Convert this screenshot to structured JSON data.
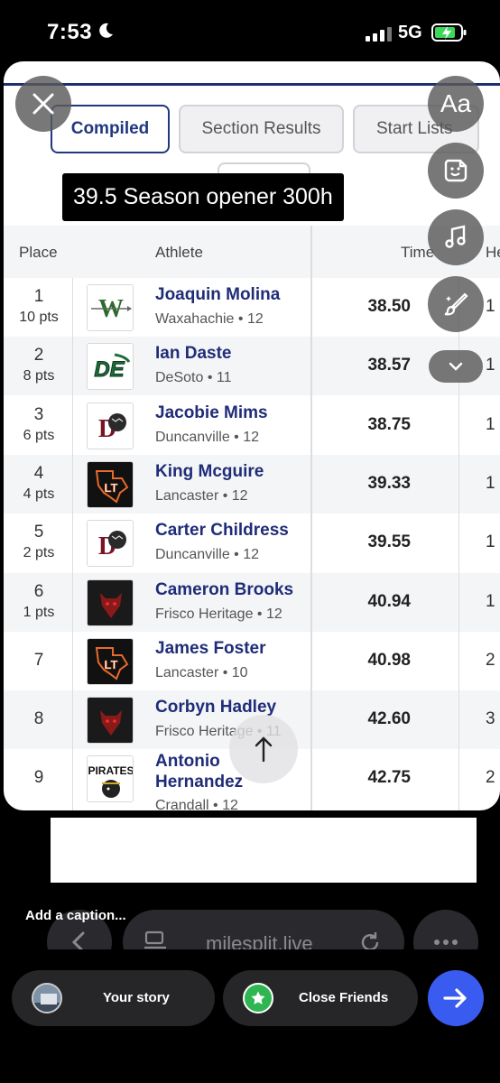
{
  "status_bar": {
    "time": "7:53",
    "network": "5G"
  },
  "tabs": {
    "compiled": "Compiled",
    "section": "Section Results",
    "start": "Start Lists"
  },
  "sticker_text": "39.5 Season opener 300h",
  "table_headers": {
    "place": "Place",
    "athlete": "Athlete",
    "time": "Time",
    "heat": "Heat"
  },
  "rows": [
    {
      "place": "1",
      "pts": "10 pts",
      "name": "Joaquin Molina",
      "team": "Waxahachie • 12",
      "time": "38.50",
      "heat": "1",
      "logo": "waxahachie-logo"
    },
    {
      "place": "2",
      "pts": "8 pts",
      "name": "Ian Daste",
      "team": "DeSoto • 11",
      "time": "38.57",
      "heat": "1",
      "logo": "desoto-logo"
    },
    {
      "place": "3",
      "pts": "6 pts",
      "name": "Jacobie Mims",
      "team": "Duncanville • 12",
      "time": "38.75",
      "heat": "1",
      "logo": "duncanville-logo"
    },
    {
      "place": "4",
      "pts": "4 pts",
      "name": "King Mcguire",
      "team": "Lancaster • 12",
      "time": "39.33",
      "heat": "1",
      "logo": "lancaster-logo"
    },
    {
      "place": "5",
      "pts": "2 pts",
      "name": "Carter Childress",
      "team": "Duncanville • 12",
      "time": "39.55",
      "heat": "1",
      "logo": "duncanville-logo"
    },
    {
      "place": "6",
      "pts": "1 pts",
      "name": "Cameron Brooks",
      "team": "Frisco Heritage • 12",
      "time": "40.94",
      "heat": "1",
      "logo": "frisco-heritage-logo"
    },
    {
      "place": "7",
      "pts": "",
      "name": "James Foster",
      "team": "Lancaster • 10",
      "time": "40.98",
      "heat": "2",
      "logo": "lancaster-logo"
    },
    {
      "place": "8",
      "pts": "",
      "name": "Corbyn Hadley",
      "team": "Frisco Heritage • 11",
      "time": "42.60",
      "heat": "3",
      "logo": "frisco-heritage-logo"
    },
    {
      "place": "9",
      "pts": "",
      "name": "Antonio Hernandez",
      "team": "Crandall • 12",
      "time": "42.75",
      "heat": "2",
      "logo": "crandall-logo"
    }
  ],
  "story_tools": {
    "text_tool": "Aa"
  },
  "caption_placeholder": "Add a caption...",
  "browser": {
    "url": "milesplit.live"
  },
  "share": {
    "your_story": "Your story",
    "close_friends": "Close Friends"
  },
  "colors": {
    "accent": "#1f3880",
    "send": "#3a5bf0",
    "close_friends": "#2fb551"
  }
}
